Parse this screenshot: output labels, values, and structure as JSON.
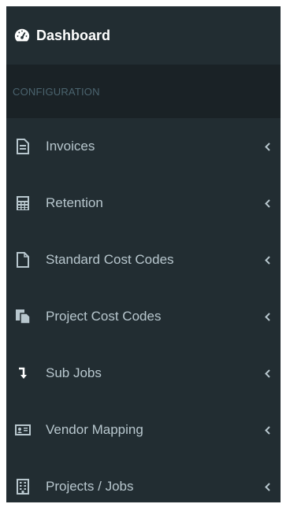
{
  "sidebar": {
    "dashboard": {
      "label": "Dashboard",
      "icon": "dashboard-icon"
    },
    "section_header": "CONFIGURATION",
    "items": [
      {
        "label": "Invoices",
        "icon": "file-text-icon"
      },
      {
        "label": "Retention",
        "icon": "calculator-icon"
      },
      {
        "label": "Standard Cost Codes",
        "icon": "file-outline-icon"
      },
      {
        "label": "Project Cost Codes",
        "icon": "copy-files-icon"
      },
      {
        "label": "Sub Jobs",
        "icon": "level-down-icon"
      },
      {
        "label": "Vendor Mapping",
        "icon": "id-card-icon"
      },
      {
        "label": "Projects / Jobs",
        "icon": "building-icon"
      }
    ]
  },
  "colors": {
    "sidebar_bg": "#222d32",
    "header_bg": "#1a2226",
    "text": "#b8c7ce",
    "header_text": "#4b646f",
    "active_text": "#ffffff"
  }
}
